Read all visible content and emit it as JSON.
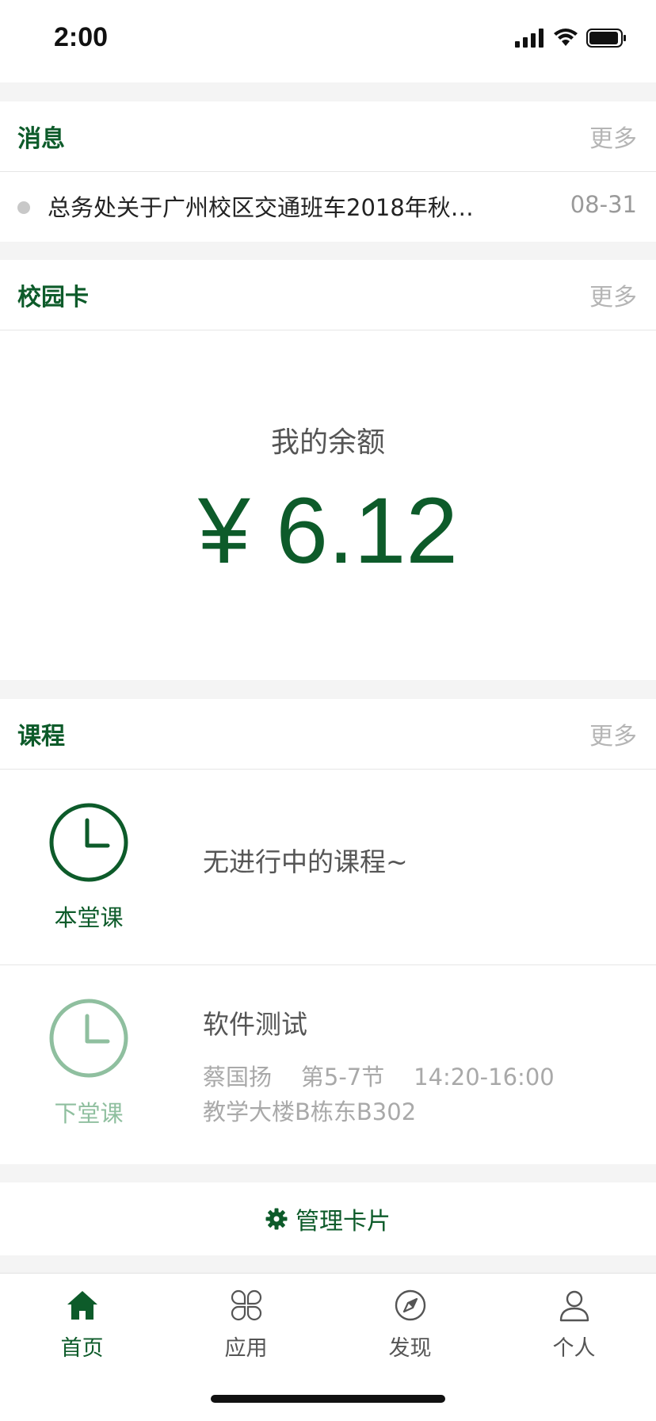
{
  "status_bar": {
    "time": "2:00"
  },
  "messages": {
    "title": "消息",
    "more": "更多",
    "items": [
      {
        "text": "总务处关于广州校区交通班车2018年秋…",
        "date": "08-31"
      }
    ]
  },
  "campus_card": {
    "title": "校园卡",
    "more": "更多",
    "balance_label": "我的余额",
    "balance_value": "¥ 6.12"
  },
  "courses": {
    "title": "课程",
    "more": "更多",
    "current": {
      "caption": "本堂课",
      "empty_text": "无进行中的课程~"
    },
    "next": {
      "caption": "下堂课",
      "name": "软件测试",
      "meta_line1": "蔡国扬    第5-7节    14:20-16:00",
      "meta_line2": "教学大楼B栋东B302"
    }
  },
  "manage": {
    "label": "管理卡片"
  },
  "tabbar": {
    "items": [
      {
        "label": "首页",
        "icon": "home-icon",
        "active": true
      },
      {
        "label": "应用",
        "icon": "apps-icon",
        "active": false
      },
      {
        "label": "发现",
        "icon": "compass-icon",
        "active": false
      },
      {
        "label": "个人",
        "icon": "person-icon",
        "active": false
      }
    ]
  },
  "colors": {
    "accent": "#0d5b2a",
    "accent_light": "#8fbf9f",
    "muted": "#b5b5b5"
  }
}
